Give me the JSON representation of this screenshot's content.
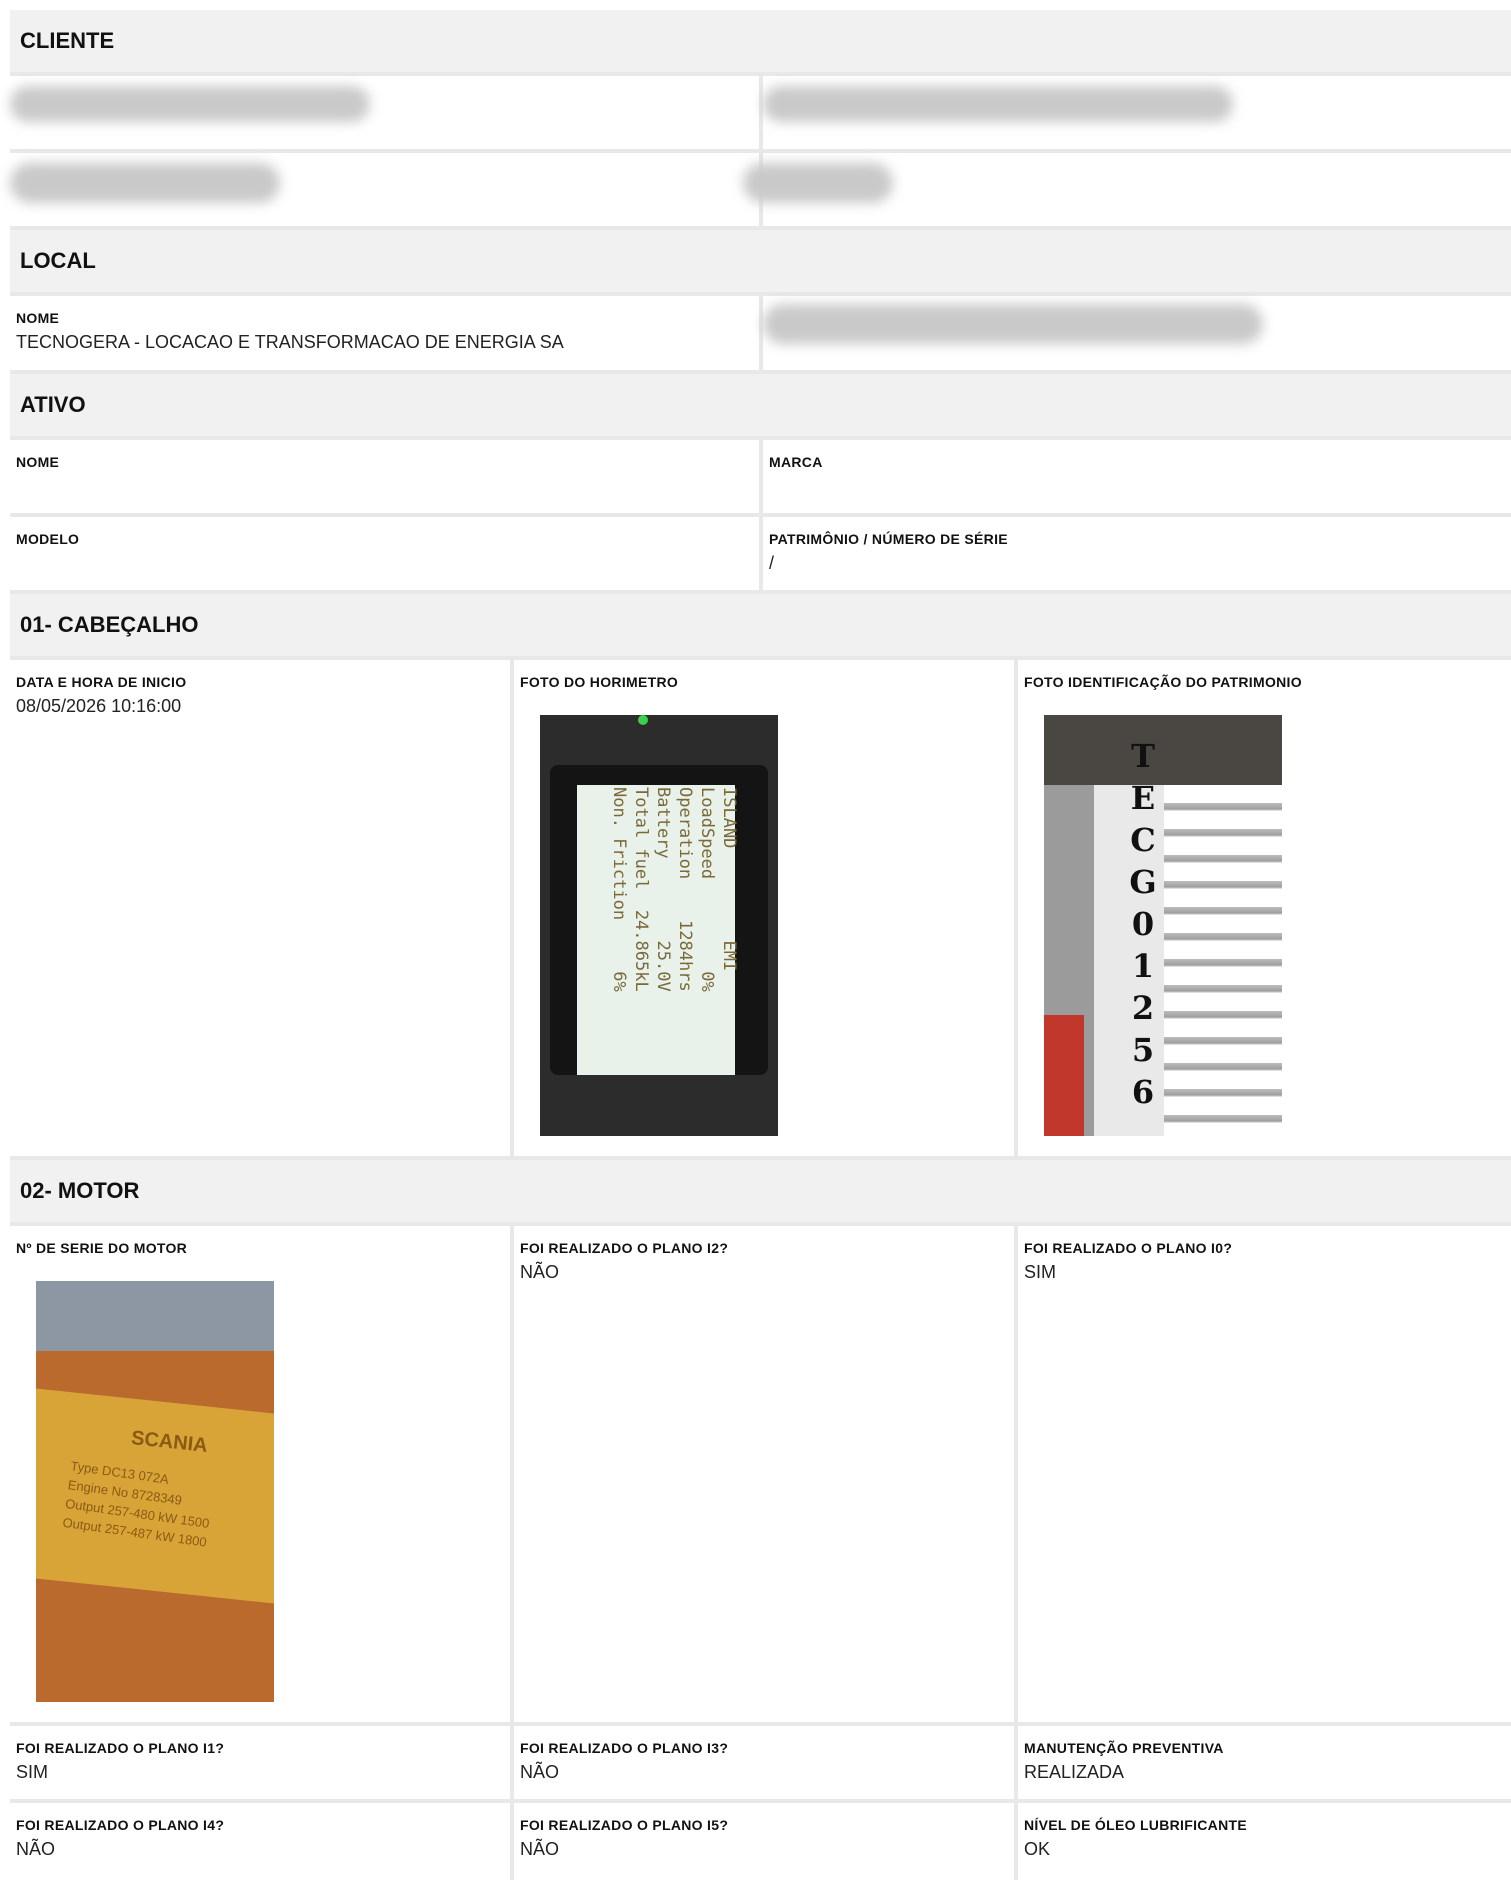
{
  "sections": {
    "cliente": "CLIENTE",
    "local": "LOCAL",
    "ativo": "ATIVO",
    "cabecalho": "01- CABEÇALHO",
    "motor": "02- MOTOR"
  },
  "local": {
    "nome_label": "NOME",
    "nome_value": "TECNOGERA - LOCACAO E TRANSFORMACAO DE ENERGIA SA"
  },
  "ativo": {
    "nome_label": "NOME",
    "marca_label": "MARCA",
    "modelo_label": "MODELO",
    "patrimonio_label": "PATRIMÔNIO / NÚMERO DE SÉRIE",
    "patrimonio_value": "/"
  },
  "cabecalho": {
    "data_label": "DATA E HORA DE INICIO",
    "data_value": "08/05/2026 10:16:00",
    "horimetro_label": "FOTO DO HORIMETRO",
    "patrimonio_label": "FOTO IDENTIFICAÇÃO DO PATRIMONIO",
    "horimetro_screen": "ISLAND         EMI\nLoadSpeed         0%\nOperation    1284hrs\nBattery        25.0V\nTotal fuel  24.865kL\nNon. Friction     6%",
    "patrimonio_text": "TECG01256"
  },
  "motor": {
    "serie_label": "Nº DE SERIE DO MOTOR",
    "i2_label": "FOI REALIZADO O PLANO I2?",
    "i2_value": "NÃO",
    "i0_label": "FOI REALIZADO O PLANO I0?",
    "i0_value": "SIM",
    "i1_label": "FOI REALIZADO O PLANO I1?",
    "i1_value": "SIM",
    "i3_label": "FOI REALIZADO O PLANO I3?",
    "i3_value": "NÃO",
    "prev_label": "MANUTENÇÃO PREVENTIVA",
    "prev_value": "REALIZADA",
    "i4_label": "FOI REALIZADO O PLANO I4?",
    "i4_value": "NÃO",
    "i5_label": "FOI REALIZADO O PLANO I5?",
    "i5_value": "NÃO",
    "oleo_label": "NÍVEL DE ÓLEO LUBRIFICANTE",
    "oleo_value": "OK",
    "plate_brand": "SCANIA",
    "plate_lines": "Type DC13 072A\nEngine No 8728349\nOutput 257-480 kW 1500\nOutput 257-487 kW 1800"
  }
}
